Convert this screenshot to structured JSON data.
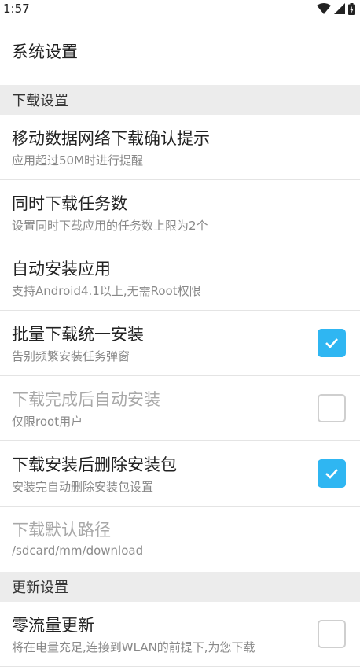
{
  "status_bar": {
    "time": "1:57",
    "icons": [
      "wifi-icon",
      "signal-icon",
      "battery-charging-icon"
    ]
  },
  "header": {
    "title": "系统设置"
  },
  "sections": [
    {
      "label": "下载设置",
      "rows": [
        {
          "title": "移动数据网络下载确认提示",
          "subtitle": "应用超过50M时进行提醒"
        },
        {
          "title": "同时下载任务数",
          "subtitle": "设置同时下载应用的任务数上限为2个"
        },
        {
          "title": "自动安装应用",
          "subtitle": "支持Android4.1以上,无需Root权限"
        },
        {
          "title": "批量下载统一安装",
          "subtitle": "告别频繁安装任务弹窗",
          "checked": true
        },
        {
          "title": "下载完成后自动安装",
          "subtitle": "仅限root用户",
          "checked": false,
          "enabled": false
        },
        {
          "title": "下载安装后删除安装包",
          "subtitle": "安装完自动删除安装包设置",
          "checked": true
        },
        {
          "title": "下载默认路径",
          "subtitle": "/sdcard/mm/download",
          "enabled": false
        }
      ]
    },
    {
      "label": "更新设置",
      "rows": [
        {
          "title": "零流量更新",
          "subtitle": "将在电量充足,连接到WLAN的前提下,为您下载",
          "checked": false
        }
      ]
    }
  ],
  "colors": {
    "accent": "#2fb6f2",
    "section_bg": "#ececec"
  }
}
